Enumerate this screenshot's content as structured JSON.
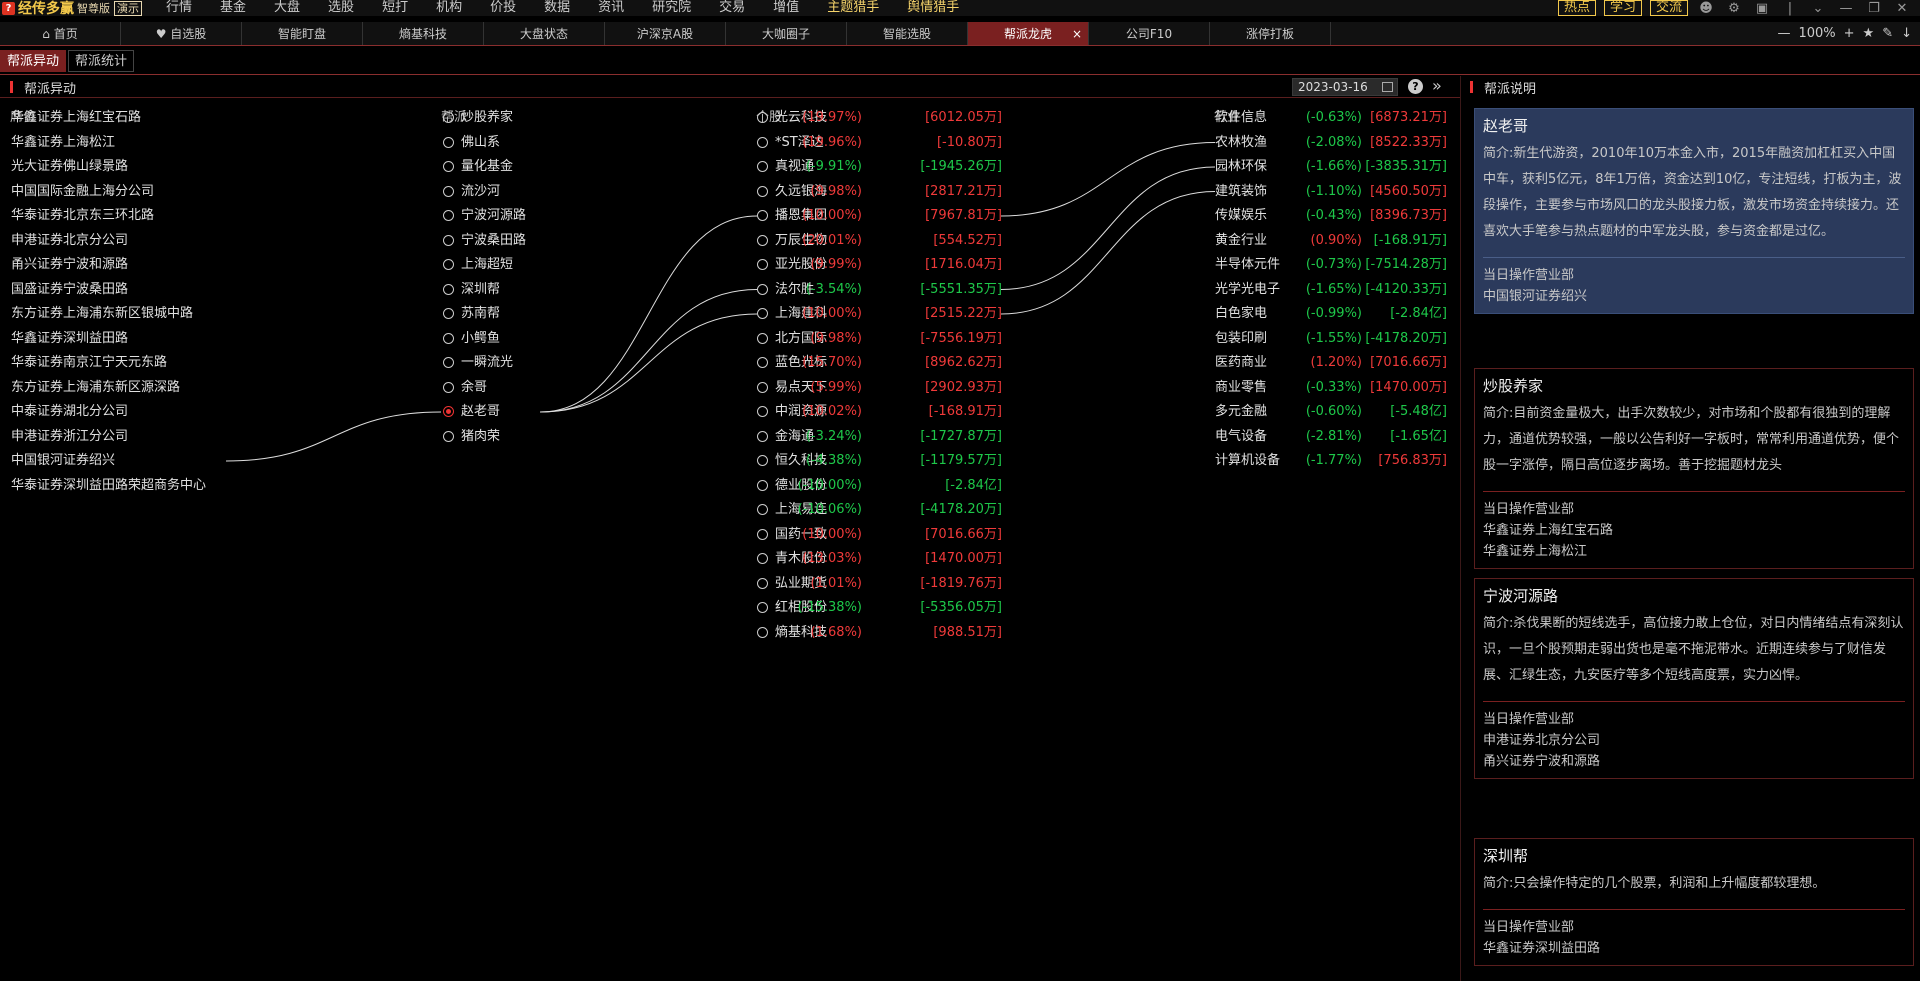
{
  "app": {
    "logo_mark": "?",
    "name": "经传多赢",
    "edition": "智尊版",
    "demo": "演示"
  },
  "menu": [
    {
      "label": "行情",
      "dot": false,
      "yellow": false
    },
    {
      "label": "基金",
      "dot": false,
      "yellow": false
    },
    {
      "label": "大盘",
      "dot": false,
      "yellow": false
    },
    {
      "label": "选股",
      "dot": false,
      "yellow": false
    },
    {
      "label": "短打",
      "dot": false,
      "yellow": false
    },
    {
      "label": "机构",
      "dot": true,
      "yellow": false
    },
    {
      "label": "价投",
      "dot": false,
      "yellow": false
    },
    {
      "label": "数据",
      "dot": false,
      "yellow": false
    },
    {
      "label": "资讯",
      "dot": false,
      "yellow": false
    },
    {
      "label": "研究院",
      "dot": true,
      "yellow": false
    },
    {
      "label": "交易",
      "dot": false,
      "yellow": false
    },
    {
      "label": "增值",
      "dot": true,
      "yellow": false
    },
    {
      "label": "主题猎手",
      "dot": true,
      "yellow": true
    },
    {
      "label": "舆情猎手",
      "dot": true,
      "yellow": true
    }
  ],
  "top_buttons": [
    "热点",
    "学习",
    "交流"
  ],
  "tabs": [
    {
      "label": "首页",
      "icon": "home-icon",
      "active": false
    },
    {
      "label": "自选股",
      "icon": "heart-icon",
      "active": false
    },
    {
      "label": "智能盯盘",
      "icon": "",
      "active": false
    },
    {
      "label": "熵基科技",
      "icon": "",
      "active": false
    },
    {
      "label": "大盘状态",
      "icon": "",
      "active": false
    },
    {
      "label": "沪深京A股",
      "icon": "",
      "active": false
    },
    {
      "label": "大咖圈子",
      "icon": "",
      "active": false
    },
    {
      "label": "智能选股",
      "icon": "",
      "active": false
    },
    {
      "label": "帮派龙虎",
      "icon": "",
      "active": true
    },
    {
      "label": "公司F10",
      "icon": "",
      "active": false
    },
    {
      "label": "涨停打板",
      "icon": "",
      "active": false
    }
  ],
  "tab_tools": {
    "zoom": "100%"
  },
  "subtabs": [
    {
      "label": "帮派异动",
      "active": true
    },
    {
      "label": "帮派统计",
      "active": false
    }
  ],
  "panel": {
    "title": "帮派异动",
    "date": "2023-03-16"
  },
  "columns": {
    "seat": "席位",
    "gang": "帮派",
    "stock": "个股",
    "industry": "行业"
  },
  "seats": [
    "华鑫证券上海红宝石路",
    "华鑫证券上海松江",
    "光大证券佛山绿景路",
    "中国国际金融上海分公司",
    "华泰证券北京东三环北路",
    "申港证券北京分公司",
    "甬兴证券宁波和源路",
    "国盛证券宁波桑田路",
    "东方证券上海浦东新区银城中路",
    "华鑫证券深圳益田路",
    "华泰证券南京江宁天元东路",
    "东方证券上海浦东新区源深路",
    "中泰证券湖北分公司",
    "申港证券浙江分公司",
    "中国银河证券绍兴",
    "华泰证券深圳益田路荣超商务中心"
  ],
  "gangs": [
    {
      "name": "炒股养家",
      "selected": false
    },
    {
      "name": "佛山系",
      "selected": false
    },
    {
      "name": "量化基金",
      "selected": false
    },
    {
      "name": "流沙河",
      "selected": false
    },
    {
      "name": "宁波河源路",
      "selected": false
    },
    {
      "name": "宁波桑田路",
      "selected": false
    },
    {
      "name": "上海超短",
      "selected": false
    },
    {
      "name": "深圳帮",
      "selected": false
    },
    {
      "name": "苏南帮",
      "selected": false
    },
    {
      "name": "小鳄鱼",
      "selected": false
    },
    {
      "name": "一瞬流光",
      "selected": false
    },
    {
      "name": "余哥",
      "selected": false
    },
    {
      "name": "赵老哥",
      "selected": true
    },
    {
      "name": "猪肉荣",
      "selected": false
    }
  ],
  "stocks": [
    {
      "name": "光云科技",
      "pct": "(19.97%)",
      "amt": "[6012.05万]",
      "up": true
    },
    {
      "name": "*ST泽达",
      "pct": "(19.96%)",
      "amt": "[-10.80万]",
      "up": true
    },
    {
      "name": "真视通",
      "pct": "(-9.91%)",
      "amt": "[-1945.26万]",
      "up": false
    },
    {
      "name": "久远银海",
      "pct": "(9.98%)",
      "amt": "[2817.21万]",
      "up": true
    },
    {
      "name": "播恩集团",
      "pct": "(10.00%)",
      "amt": "[7967.81万]",
      "up": true
    },
    {
      "name": "万辰生物",
      "pct": "(20.01%)",
      "amt": "[554.52万]",
      "up": true
    },
    {
      "name": "亚光股份",
      "pct": "(9.99%)",
      "amt": "[1716.04万]",
      "up": true
    },
    {
      "name": "法尔胜",
      "pct": "(-3.54%)",
      "amt": "[-5551.35万]",
      "up": false
    },
    {
      "name": "上海建科",
      "pct": "(10.00%)",
      "amt": "[2515.22万]",
      "up": true
    },
    {
      "name": "北方国际",
      "pct": "(9.98%)",
      "amt": "[-7556.19万]",
      "up": true
    },
    {
      "name": "蓝色光标",
      "pct": "(15.70%)",
      "amt": "[8962.62万]",
      "up": true
    },
    {
      "name": "易点天下",
      "pct": "(5.99%)",
      "amt": "[2902.93万]",
      "up": true
    },
    {
      "name": "中润资源",
      "pct": "(10.02%)",
      "amt": "[-168.91万]",
      "up": true
    },
    {
      "name": "金海通",
      "pct": "(-3.24%)",
      "amt": "[-1727.87万]",
      "up": false
    },
    {
      "name": "恒久科技",
      "pct": "(-4.38%)",
      "amt": "[-1179.57万]",
      "up": false
    },
    {
      "name": "德业股份",
      "pct": "(-10.00%)",
      "amt": "[-2.84亿]",
      "up": false
    },
    {
      "name": "上海易连",
      "pct": "(-10.06%)",
      "amt": "[-4178.20万]",
      "up": false
    },
    {
      "name": "国药一致",
      "pct": "(10.00%)",
      "amt": "[7016.66万]",
      "up": true
    },
    {
      "name": "青木股份",
      "pct": "(13.03%)",
      "amt": "[1470.00万]",
      "up": true
    },
    {
      "name": "弘业期货",
      "pct": "(1.01%)",
      "amt": "[-1819.76万]",
      "up": true
    },
    {
      "name": "红相股份",
      "pct": "(-15.38%)",
      "amt": "[-5356.05万]",
      "up": false
    },
    {
      "name": "熵基科技",
      "pct": "(1.68%)",
      "amt": "[988.51万]",
      "up": true
    }
  ],
  "industries": [
    {
      "name": "软件信息",
      "pct": "(-0.63%)",
      "amt": "[6873.21万]",
      "up": false,
      "amt_up": true
    },
    {
      "name": "农林牧渔",
      "pct": "(-2.08%)",
      "amt": "[8522.33万]",
      "up": false,
      "amt_up": true
    },
    {
      "name": "园林环保",
      "pct": "(-1.66%)",
      "amt": "[-3835.31万]",
      "up": false,
      "amt_up": false
    },
    {
      "name": "建筑装饰",
      "pct": "(-1.10%)",
      "amt": "[4560.50万]",
      "up": false,
      "amt_up": true
    },
    {
      "name": "传媒娱乐",
      "pct": "(-0.43%)",
      "amt": "[8396.73万]",
      "up": false,
      "amt_up": true
    },
    {
      "name": "黄金行业",
      "pct": "(0.90%)",
      "amt": "[-168.91万]",
      "up": true,
      "amt_up": false
    },
    {
      "name": "半导体元件",
      "pct": "(-0.73%)",
      "amt": "[-7514.28万]",
      "up": false,
      "amt_up": false
    },
    {
      "name": "光学光电子",
      "pct": "(-1.65%)",
      "amt": "[-4120.33万]",
      "up": false,
      "amt_up": false
    },
    {
      "name": "白色家电",
      "pct": "(-0.99%)",
      "amt": "[-2.84亿]",
      "up": false,
      "amt_up": false
    },
    {
      "name": "包装印刷",
      "pct": "(-1.55%)",
      "amt": "[-4178.20万]",
      "up": false,
      "amt_up": false
    },
    {
      "name": "医药商业",
      "pct": "(1.20%)",
      "amt": "[7016.66万]",
      "up": true,
      "amt_up": true
    },
    {
      "name": "商业零售",
      "pct": "(-0.33%)",
      "amt": "[1470.00万]",
      "up": false,
      "amt_up": true
    },
    {
      "name": "多元金融",
      "pct": "(-0.60%)",
      "amt": "[-5.48亿]",
      "up": false,
      "amt_up": false
    },
    {
      "name": "电气设备",
      "pct": "(-2.81%)",
      "amt": "[-1.65亿]",
      "up": false,
      "amt_up": false
    },
    {
      "name": "计算机设备",
      "pct": "(-1.77%)",
      "amt": "[756.83万]",
      "up": false,
      "amt_up": true
    }
  ],
  "links": {
    "seat_to_gang": [
      [
        14,
        12
      ]
    ],
    "gang_to_stock": [
      [
        12,
        4
      ],
      [
        12,
        7
      ],
      [
        12,
        8
      ]
    ],
    "stock_to_industry": [
      [
        4,
        1
      ],
      [
        7,
        2
      ],
      [
        8,
        3
      ]
    ]
  },
  "side": {
    "title": "帮派说明",
    "seat_label": "当日操作营业部",
    "cards": [
      {
        "name": "赵老哥",
        "active": true,
        "desc": "简介:新生代游资，2010年10万本金入市，2015年融资加杠杠买入中国中车，获利5亿元，8年1万倍，资金达到10亿，专注短线，打板为主，波段操作，主要参与市场风口的龙头股接力板，激发市场资金持续接力。还喜欢大手笔参与热点题材的中军龙头股，参与资金都是过亿。",
        "seats": [
          "中国银河证券绍兴"
        ]
      },
      {
        "name": "炒股养家",
        "active": false,
        "desc": "简介:目前资金量极大，出手次数较少，对市场和个股都有很独到的理解力，通道优势较强，一般以公告利好一字板时，常常利用通道优势，便个股一字涨停，隔日高位逐步离场。善于挖掘题材龙头",
        "seats": [
          "华鑫证券上海红宝石路",
          "华鑫证券上海松江"
        ]
      },
      {
        "name": "宁波河源路",
        "active": false,
        "desc": "简介:杀伐果断的短线选手，高位接力敢上仓位，对日内情绪结点有深刻认识，一旦个股预期走弱出货也是毫不拖泥带水。近期连续参与了财信发展、汇绿生态，九安医疗等多个短线高度票，实力凶悍。",
        "seats": [
          "申港证券北京分公司",
          "甬兴证券宁波和源路"
        ]
      },
      {
        "name": "深圳帮",
        "active": false,
        "desc": "简介:只会操作特定的几个股票，利润和上升幅度都较理想。",
        "seats": [
          "华鑫证券深圳益田路"
        ]
      }
    ]
  }
}
